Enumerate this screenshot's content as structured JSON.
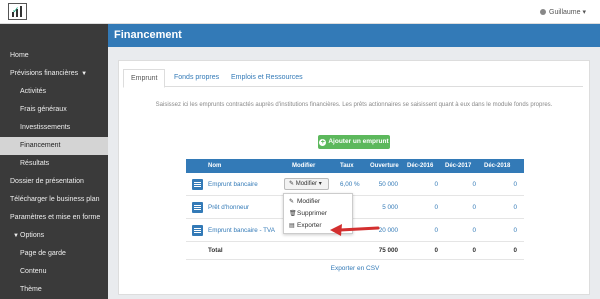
{
  "topbar": {
    "user_name": "Guillaume"
  },
  "sidebar": {
    "items": [
      {
        "label": "Home"
      },
      {
        "label": "Prévisions financières"
      },
      {
        "label": "Activités"
      },
      {
        "label": "Frais généraux"
      },
      {
        "label": "Investissements"
      },
      {
        "label": "Financement"
      },
      {
        "label": "Résultats"
      },
      {
        "label": "Dossier de présentation"
      },
      {
        "label": "Télécharger le business plan"
      },
      {
        "label": "Paramètres et mise en forme"
      },
      {
        "label": "Options"
      },
      {
        "label": "Page de garde"
      },
      {
        "label": "Contenu"
      },
      {
        "label": "Thème"
      }
    ]
  },
  "page": {
    "title": "Financement"
  },
  "tabs": [
    {
      "label": "Emprunt"
    },
    {
      "label": "Fonds propres"
    },
    {
      "label": "Emplois et Ressources"
    }
  ],
  "intro": "Saisissez ici les emprunts contractés auprès d'institutions financières. Les prêts actionnaires se saisissent quant à eux dans le module fonds propres.",
  "add_button": "Ajouter un emprunt",
  "table": {
    "headers": {
      "nom": "Nom",
      "modifier": "Modifier",
      "taux": "Taux",
      "ouverture": "Ouverture",
      "d16": "Déc-2016",
      "d17": "Déc-2017",
      "d18": "Déc-2018"
    },
    "rows": [
      {
        "nom": "Emprunt bancaire",
        "taux": "6,00 %",
        "ouverture": "50 000",
        "d16": "0",
        "d17": "0",
        "d18": "0"
      },
      {
        "nom": "Prêt d'honneur",
        "taux": "",
        "ouverture": "5 000",
        "d16": "0",
        "d17": "0",
        "d18": "0"
      },
      {
        "nom": "Emprunt bancaire - TVA",
        "taux": "",
        "ouverture": "20 000",
        "d16": "0",
        "d17": "0",
        "d18": "0"
      }
    ],
    "total": {
      "label": "Total",
      "ouverture": "75 000",
      "d16": "0",
      "d17": "0",
      "d18": "0"
    },
    "modifier_button": "Modifier"
  },
  "dropdown": {
    "items": [
      {
        "label": "Modifier"
      },
      {
        "label": "Supprimer"
      },
      {
        "label": "Exporter"
      }
    ]
  },
  "export_link": "Exporter en CSV",
  "colors": {
    "primary": "#337ab7",
    "success": "#5cb85c",
    "sidebar": "#3a3a3a",
    "arrow": "#d32f2f"
  }
}
